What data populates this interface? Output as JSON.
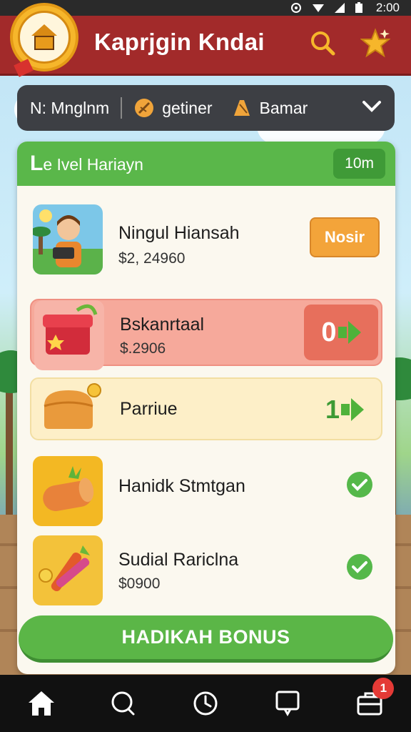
{
  "status_bar": {
    "time": "2:00"
  },
  "header": {
    "title": "Kaprjgin Kndai"
  },
  "filter_bar": {
    "item1": "N: Mnglnm",
    "item2": "getiner",
    "item3": "Bamar"
  },
  "panel": {
    "title_letter": "L",
    "title_rest": "e Ivel Hariayn",
    "chip": "10m"
  },
  "items": [
    {
      "name": "Ningul Hiansah",
      "price": "$2, 24960",
      "action": "Nosir",
      "thumb": "avatar"
    },
    {
      "name": "Bskanrtaal",
      "price": "$.2906",
      "action_count": "0",
      "thumb": "red-chest"
    },
    {
      "name": "Parriue",
      "price": "",
      "action_count": "1",
      "thumb": "bread"
    },
    {
      "name": "Hanidk Stmtgan",
      "price": "",
      "thumb": "wood-log"
    },
    {
      "name": "Sudial Rariclna",
      "price": "$0900",
      "thumb": "tools"
    }
  ],
  "bonus_button": "HADIKAH BONUS",
  "bottom_nav": {
    "notification_count": "1"
  },
  "colors": {
    "header_red": "#a22a2a",
    "accent_green": "#5ab74a",
    "orange": "#f3a43a",
    "salmon": "#e76f5c"
  }
}
